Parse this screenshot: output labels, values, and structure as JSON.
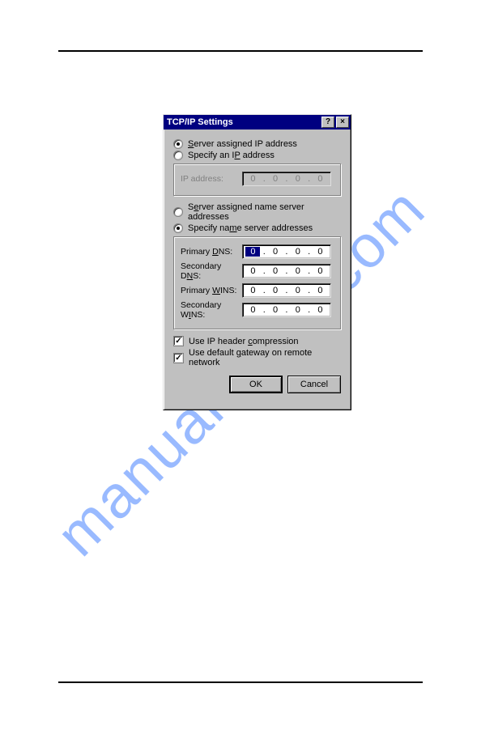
{
  "watermark": "manualshive.com",
  "dialog": {
    "title": "TCP/IP Settings",
    "help_glyph": "?",
    "close_glyph": "×",
    "radio_ip": {
      "server": "Server assigned IP address",
      "specify": "Specify an IP address"
    },
    "ip_group": {
      "label": "IP address:",
      "octets": [
        "0",
        "0",
        "0",
        "0"
      ]
    },
    "radio_ns": {
      "server": "Server assigned name server addresses",
      "specify": "Specify name server addresses"
    },
    "ns_group": {
      "primary_dns": "Primary DNS:",
      "secondary_dns": "Secondary DNS:",
      "primary_wins": "Primary WINS:",
      "secondary_wins": "Secondary WINS:",
      "pdns": [
        "0",
        "0",
        "0",
        "0"
      ],
      "sdns": [
        "0",
        "0",
        "0",
        "0"
      ],
      "pwins": [
        "0",
        "0",
        "0",
        "0"
      ],
      "swins": [
        "0",
        "0",
        "0",
        "0"
      ]
    },
    "checks": {
      "compression": "Use IP header compression",
      "gateway": "Use default gateway on remote network"
    },
    "buttons": {
      "ok": "OK",
      "cancel": "Cancel"
    }
  }
}
